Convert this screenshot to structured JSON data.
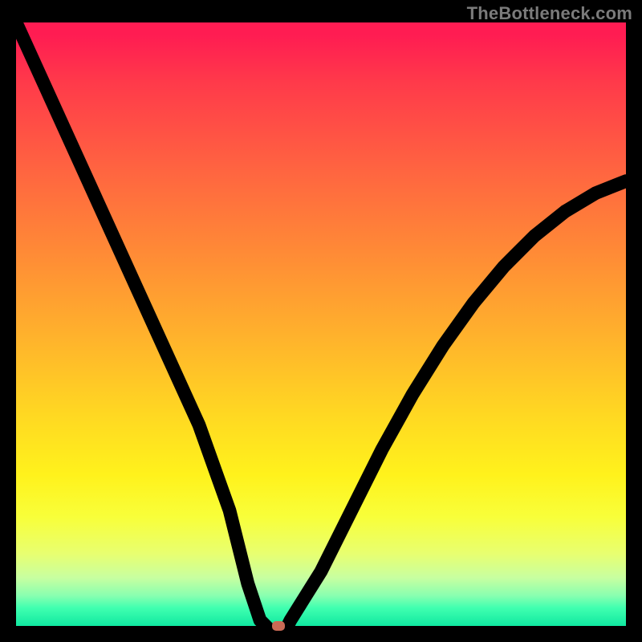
{
  "watermark": {
    "text": "TheBottleneck.com"
  },
  "colors": {
    "frame": "#000000",
    "curve": "#000000",
    "marker": "#c96a55",
    "watermark": "#7b7b7b"
  },
  "chart_data": {
    "type": "line",
    "title": "",
    "xlabel": "",
    "ylabel": "",
    "xlim": [
      0,
      100
    ],
    "ylim": [
      0,
      100
    ],
    "x": [
      0,
      5,
      10,
      15,
      20,
      25,
      30,
      35,
      38,
      40,
      42,
      44,
      45,
      50,
      55,
      60,
      65,
      70,
      75,
      80,
      85,
      90,
      95,
      100
    ],
    "y": [
      100,
      89,
      78,
      67,
      56,
      45,
      34,
      20,
      8,
      2,
      0,
      0,
      2,
      10,
      20,
      30,
      39,
      47,
      54,
      60,
      65,
      69,
      72,
      74
    ],
    "marker": {
      "x": 43,
      "y": 0
    },
    "grid": false
  }
}
